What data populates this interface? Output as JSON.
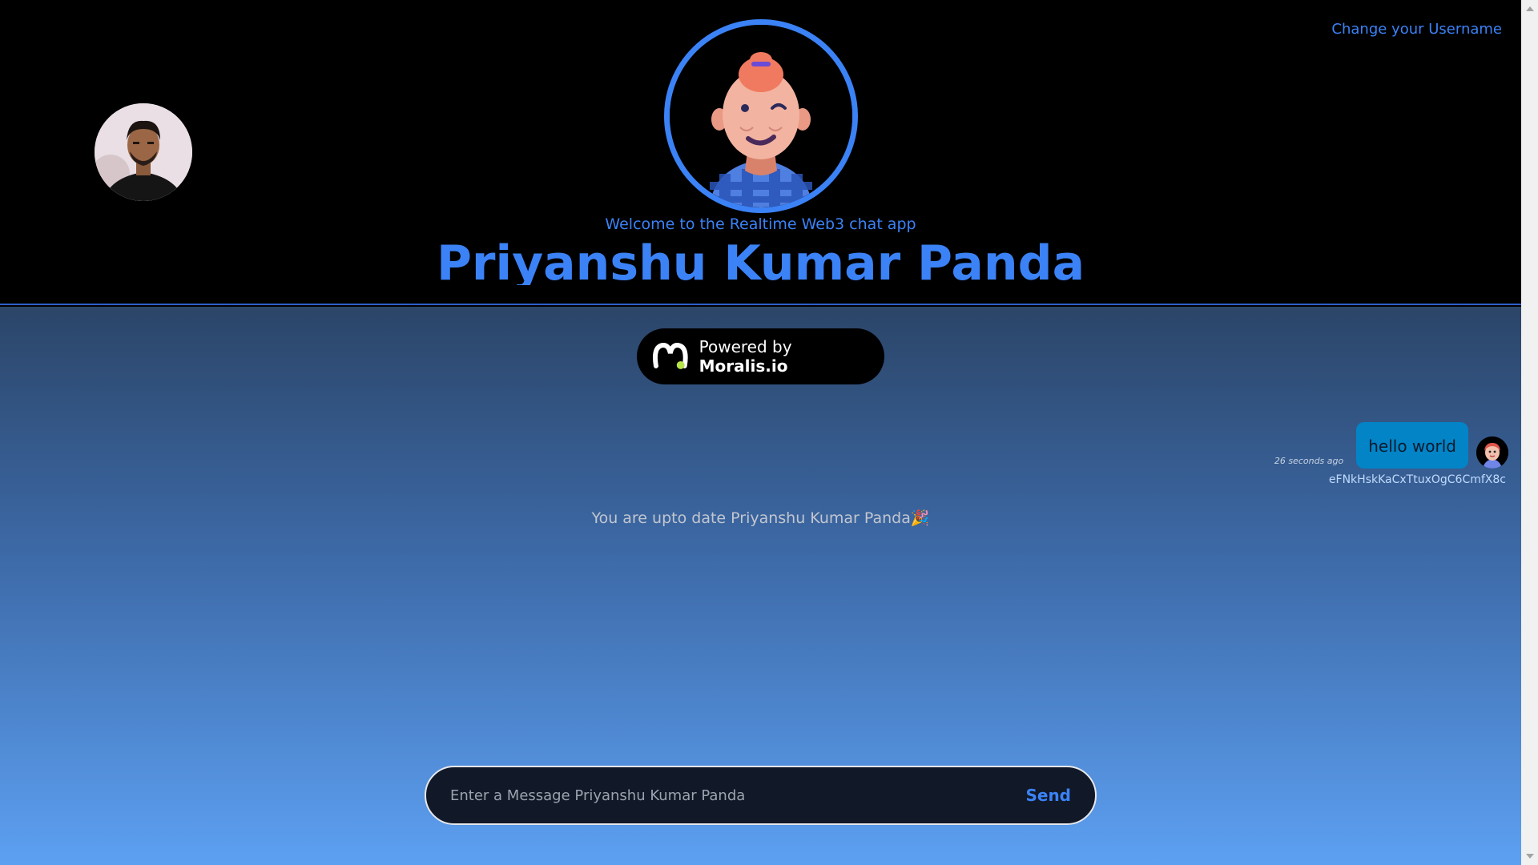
{
  "header": {
    "change_username_label": "Change your Username",
    "welcome_text": "Welcome to the Realtime Web3 chat app",
    "username": "Priyanshu Kumar Panda"
  },
  "badge": {
    "prefix": "Powered by ",
    "brand": "Moralis.io"
  },
  "messages": [
    {
      "text": "hello world",
      "time": "26 seconds ago",
      "sender": "eFNkHskKaCxTtuxOgC6CmfX8c"
    }
  ],
  "status": {
    "up_to_date": "You are upto date Priyanshu Kumar Panda🎉"
  },
  "composer": {
    "placeholder": "Enter a Message Priyanshu Kumar Panda",
    "send_label": "Send"
  },
  "colors": {
    "accent": "#3b82f6",
    "bubble": "#0284c7",
    "header_bg": "#000000"
  },
  "icons": {
    "profile": "user-photo-avatar",
    "main_avatar": "cartoon-avatar",
    "brand": "moralis-logo-icon",
    "message_avatar": "small-avatar-icon"
  }
}
